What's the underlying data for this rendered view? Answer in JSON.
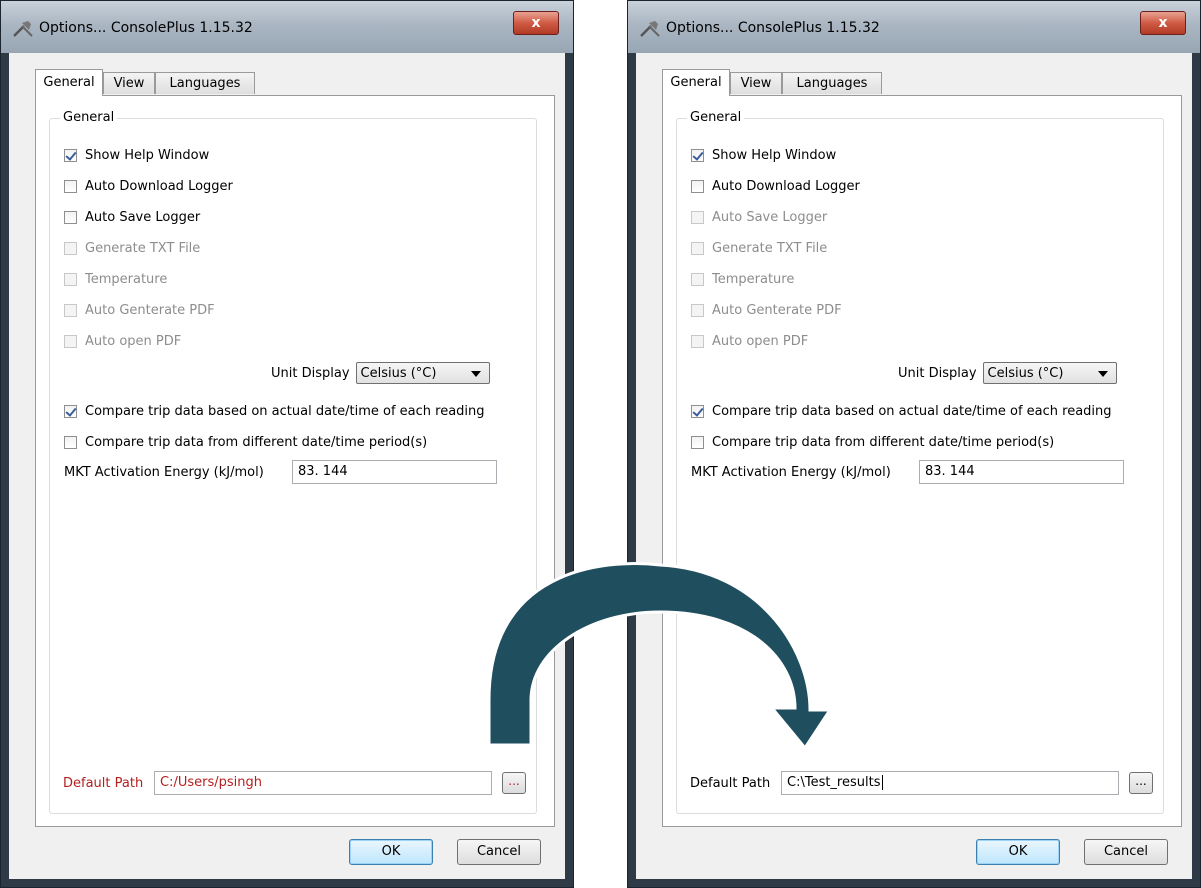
{
  "windows": [
    {
      "title": "Options... ConsolePlus 1.15.32",
      "close_label": "x",
      "tabs": [
        "General",
        "View",
        "Languages"
      ],
      "group_label": "General",
      "checkboxes": [
        {
          "label": "Show Help Window",
          "checked": true,
          "disabled": false
        },
        {
          "label": "Auto Download Logger",
          "checked": false,
          "disabled": false
        },
        {
          "label": "Auto Save Logger",
          "checked": false,
          "disabled": false
        },
        {
          "label": "Generate TXT File",
          "checked": false,
          "disabled": true
        },
        {
          "label": "Temperature",
          "checked": false,
          "disabled": true
        },
        {
          "label": "Auto Genterate PDF",
          "checked": false,
          "disabled": true
        },
        {
          "label": "Auto open PDF",
          "checked": false,
          "disabled": true
        }
      ],
      "unit_display_label": "Unit Display",
      "unit_display_value": "Celsius (°C)",
      "compare_checkboxes": [
        {
          "label": "Compare trip data based on actual date/time of each reading",
          "checked": true
        },
        {
          "label": "Compare trip data from different date/time period(s)",
          "checked": false
        }
      ],
      "mkt_label": "MKT Activation Energy (kJ/mol)",
      "mkt_value": "83. 144",
      "default_path_label": "Default Path",
      "default_path_value": "C:/Users/psingh",
      "browse_label": "...",
      "ok_label": "OK",
      "cancel_label": "Cancel"
    },
    {
      "title": "Options... ConsolePlus 1.15.32",
      "close_label": "x",
      "tabs": [
        "General",
        "View",
        "Languages"
      ],
      "group_label": "General",
      "checkboxes": [
        {
          "label": "Show Help Window",
          "checked": true,
          "disabled": false
        },
        {
          "label": "Auto Download Logger",
          "checked": false,
          "disabled": false
        },
        {
          "label": "Auto Save Logger",
          "checked": false,
          "disabled": true
        },
        {
          "label": "Generate TXT File",
          "checked": false,
          "disabled": true
        },
        {
          "label": "Temperature",
          "checked": false,
          "disabled": true
        },
        {
          "label": "Auto Genterate PDF",
          "checked": false,
          "disabled": true
        },
        {
          "label": "Auto open PDF",
          "checked": false,
          "disabled": true
        }
      ],
      "unit_display_label": "Unit Display",
      "unit_display_value": "Celsius (°C)",
      "compare_checkboxes": [
        {
          "label": "Compare trip data based on actual date/time of each reading",
          "checked": true
        },
        {
          "label": "Compare trip data from different date/time period(s)",
          "checked": false
        }
      ],
      "mkt_label": "MKT Activation Energy (kJ/mol)",
      "mkt_value": "83. 144",
      "default_path_label": "Default Path",
      "default_path_value": "C:\\Test_results",
      "browse_label": "...",
      "ok_label": "OK",
      "cancel_label": "Cancel"
    }
  ],
  "colors": {
    "invalid_path": "#b31f1f",
    "arrow": "#1f4e5f"
  }
}
